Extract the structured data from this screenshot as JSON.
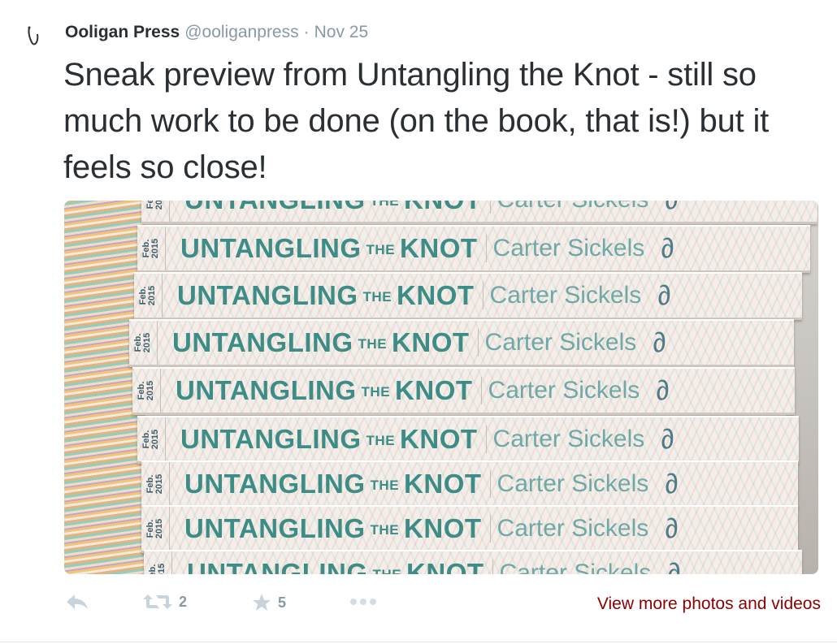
{
  "tweet": {
    "author_name": "Ooligan Press",
    "handle": "@ooliganpress",
    "separator": "·",
    "date": "Nov 25",
    "text": "Sneak preview from Untangling the Knot - still so much work to be done (on the book, that is!) but it feels so close!"
  },
  "photo": {
    "spine_date": "Feb.\n2015",
    "spine_title_1": "UNTANGLING",
    "spine_title_the": "THE",
    "spine_title_2": "KNOT",
    "spine_author": "Carter Sickels",
    "spine_logo": "∂"
  },
  "actions": {
    "reply_icon": "reply-icon",
    "retweet_icon": "retweet-icon",
    "retweet_count": "2",
    "favorite_icon": "star-icon",
    "favorite_count": "5",
    "more_icon": "more-dots-icon",
    "view_more": "View more photos and videos"
  },
  "colors": {
    "link": "#8b0000",
    "muted": "#8899a6",
    "text": "#292f33"
  }
}
